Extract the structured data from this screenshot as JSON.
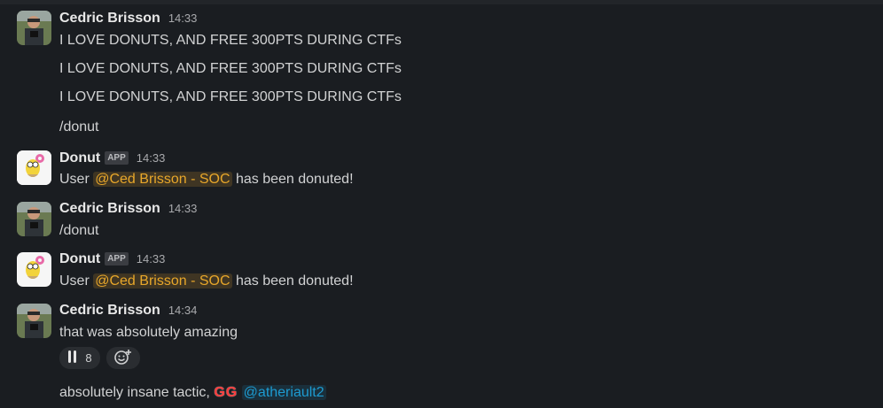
{
  "messages": [
    {
      "author": "Cedric Brisson",
      "time": "14:33",
      "lines": [
        "I LOVE DONUTS, AND FREE 300PTS DURING CTFs",
        "I LOVE DONUTS, AND FREE 300PTS DURING CTFs",
        "I LOVE DONUTS, AND FREE 300PTS DURING CTFs",
        "/donut"
      ]
    },
    {
      "author": "Donut",
      "badge": "APP",
      "time": "14:33",
      "prefix": "User ",
      "mention": "@Ced Brisson - SOC",
      "suffix": " has been donuted!"
    },
    {
      "author": "Cedric Brisson",
      "time": "14:33",
      "text": "/donut"
    },
    {
      "author": "Donut",
      "badge": "APP",
      "time": "14:33",
      "prefix": "User ",
      "mention": "@Ced Brisson - SOC",
      "suffix": " has been donuted!"
    },
    {
      "author": "Cedric Brisson",
      "time": "14:34",
      "text": "that was absolutely amazing",
      "reaction": {
        "icon": "raised-hands-icon",
        "count": "8"
      },
      "add_reaction_icon": "add-emoji-icon",
      "followup_prefix": "absolutely insane tactic, ",
      "followup_emoji": "GG",
      "followup_mention": "@atheriault2"
    }
  ],
  "colors": {
    "background": "#1a1d21",
    "mention_app": "#e8a72a",
    "mention_user": "#1d9bd1",
    "gg": "#ff3b3b"
  }
}
